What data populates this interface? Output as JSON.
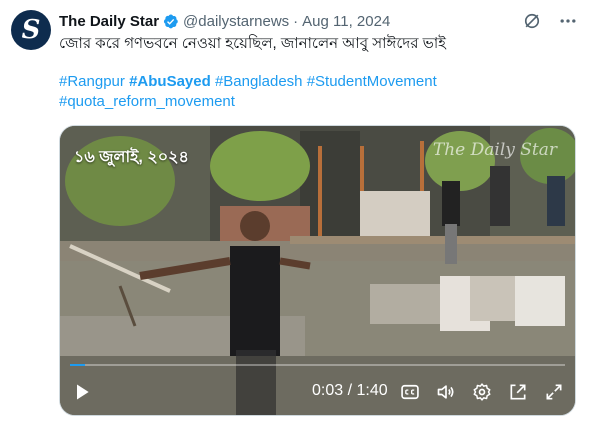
{
  "tweet": {
    "avatar_letter": "S",
    "display_name": "The Daily Star",
    "handle": "@dailystarnews",
    "separator": "·",
    "date": "Aug 11, 2024",
    "text": "জোর করে গণভবনে নেওয়া হয়েছিল, জানালেন আবু সাঈদের ভাই",
    "hashtags": [
      {
        "text": "#Rangpur",
        "bold": false
      },
      {
        "text": "#AbuSayed",
        "bold": true
      },
      {
        "text": "#Bangladesh",
        "bold": false
      },
      {
        "text": "#StudentMovement",
        "bold": false
      },
      {
        "text": "#quota_reform_movement",
        "bold": false
      }
    ]
  },
  "video": {
    "overlay_date": "১৬ জুলাই, ২০২৪",
    "watermark": "The Daily Star",
    "current_time": "0:03",
    "time_separator": " / ",
    "duration": "1:40",
    "progress_fraction": 0.03
  },
  "icons": {
    "verified": "verified-badge-icon",
    "grok": "grok-icon",
    "more": "more-icon",
    "play": "play-icon",
    "captions": "captions-icon",
    "volume": "volume-icon",
    "settings": "settings-icon",
    "popout": "popout-icon",
    "fullscreen": "fullscreen-icon"
  },
  "colors": {
    "link": "#1d9bf0",
    "text": "#0f1419",
    "secondary": "#536471",
    "verified": "#1d9bf0"
  }
}
